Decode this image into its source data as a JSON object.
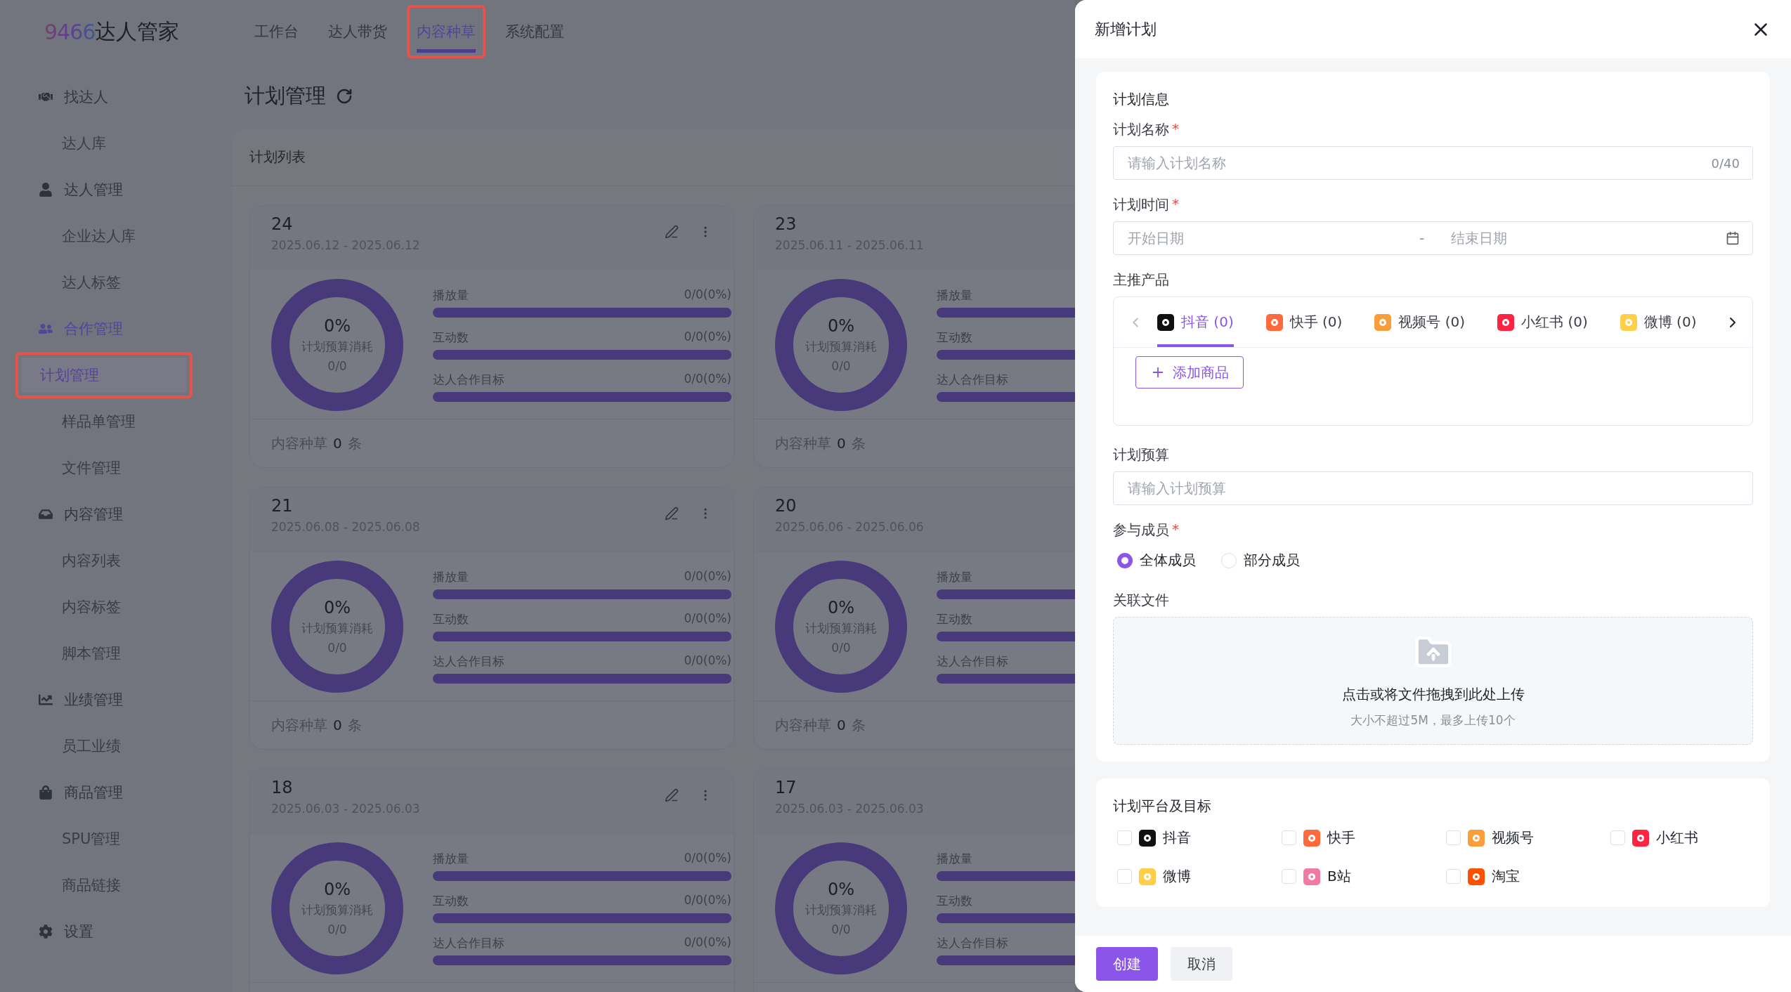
{
  "logo": {
    "number": "9466",
    "name": "达人管家"
  },
  "top_nav": [
    {
      "label": "工作台",
      "selected": false,
      "highlighted": false
    },
    {
      "label": "达人带货",
      "selected": false,
      "highlighted": false
    },
    {
      "label": "内容种草",
      "selected": true,
      "highlighted": true
    },
    {
      "label": "系统配置",
      "selected": false,
      "highlighted": false
    }
  ],
  "sidebar": {
    "items": [
      {
        "label": "找达人",
        "active": false,
        "children": [
          {
            "label": "达人库",
            "selected": false,
            "highlighted": false
          }
        ]
      },
      {
        "label": "达人管理",
        "active": false,
        "children": [
          {
            "label": "企业达人库",
            "selected": false,
            "highlighted": false
          },
          {
            "label": "达人标签",
            "selected": false,
            "highlighted": false
          }
        ]
      },
      {
        "label": "合作管理",
        "active": true,
        "children": [
          {
            "label": "计划管理",
            "selected": true,
            "highlighted": true
          },
          {
            "label": "样品单管理",
            "selected": false,
            "highlighted": false
          },
          {
            "label": "文件管理",
            "selected": false,
            "highlighted": false
          }
        ]
      },
      {
        "label": "内容管理",
        "active": false,
        "children": [
          {
            "label": "内容列表",
            "selected": false,
            "highlighted": false
          },
          {
            "label": "内容标签",
            "selected": false,
            "highlighted": false
          },
          {
            "label": "脚本管理",
            "selected": false,
            "highlighted": false
          }
        ]
      },
      {
        "label": "业绩管理",
        "active": false,
        "children": [
          {
            "label": "员工业绩",
            "selected": false,
            "highlighted": false
          }
        ]
      },
      {
        "label": "商品管理",
        "active": false,
        "children": [
          {
            "label": "SPU管理",
            "selected": false,
            "highlighted": false
          },
          {
            "label": "商品链接",
            "selected": false,
            "highlighted": false
          }
        ]
      },
      {
        "label": "设置",
        "active": false
      }
    ]
  },
  "page": {
    "title": "计划管理"
  },
  "panel": {
    "title": "计划列表",
    "cards": [
      {
        "number": "24",
        "dates": "2025.06.12 - 2025.06.12",
        "actions": true,
        "donut": {
          "percent": "0%",
          "label": "计划预算消耗",
          "value": "0/0"
        },
        "metrics": [
          {
            "label": "播放量",
            "value": "0/0(0%)",
            "level": 0
          },
          {
            "label": "互动数",
            "value": "0/0(0%)",
            "level": 0
          },
          {
            "label": "达人合作目标",
            "value": "0/0(0%)",
            "level": 0
          }
        ],
        "footer": {
          "label": "内容种草",
          "count": "0",
          "unit": "条"
        }
      },
      {
        "number": "23",
        "dates": "2025.06.11 - 2025.06.11",
        "donut": {
          "percent": "0%",
          "label": "计划预算消耗",
          "value": "0/0"
        },
        "metrics": [
          {
            "label": "播放量",
            "level": 0
          },
          {
            "label": "互动数",
            "level": 0
          },
          {
            "label": "达人合作目标",
            "level": 0
          }
        ],
        "footer": {
          "label": "内容种草",
          "count": "0",
          "unit": "条"
        }
      },
      {
        "number": "21",
        "dates": "2025.06.08 - 2025.06.08",
        "actions": true,
        "donut": {
          "percent": "0%",
          "label": "计划预算消耗",
          "value": "0/0"
        },
        "metrics": [
          {
            "label": "播放量",
            "value": "0/0(0%)",
            "level": 0
          },
          {
            "label": "互动数",
            "value": "0/0(0%)",
            "level": 0
          },
          {
            "label": "达人合作目标",
            "value": "0/0(0%)",
            "level": 0
          }
        ],
        "footer": {
          "label": "内容种草",
          "count": "0",
          "unit": "条"
        }
      },
      {
        "number": "20",
        "dates": "2025.06.06 - 2025.06.06",
        "donut": {
          "percent": "0%",
          "label": "计划预算消耗",
          "value": "0/0"
        },
        "metrics": [
          {
            "label": "播放量",
            "level": 0
          },
          {
            "label": "互动数",
            "level": 0
          },
          {
            "label": "达人合作目标",
            "level": 0
          }
        ],
        "footer": {
          "label": "内容种草",
          "count": "0",
          "unit": "条"
        }
      },
      {
        "number": "18",
        "dates": "2025.06.03 - 2025.06.03",
        "actions": true,
        "donut": {
          "percent": "0%",
          "label": "计划预算消耗",
          "value": "0/0"
        },
        "metrics": [
          {
            "label": "播放量",
            "value": "0/0(0%)",
            "level": 0
          },
          {
            "label": "互动数",
            "value": "0/0(0%)",
            "level": 0
          },
          {
            "label": "达人合作目标",
            "value": "0/0(0%)",
            "level": 0
          }
        ]
      },
      {
        "number": "17",
        "dates": "2025.06.03 - 2025.06.03",
        "donut": {
          "percent": "0%",
          "label": "计划预算消耗",
          "value": "0/0"
        },
        "metrics": [
          {
            "label": "播放量",
            "level": 0
          },
          {
            "label": "互动数",
            "level": 0
          },
          {
            "label": "达人合作目标",
            "level": 0
          }
        ]
      }
    ]
  },
  "drawer": {
    "title": "新增计划",
    "info": {
      "heading": "计划信息",
      "name_field": {
        "label": "计划名称",
        "required_mark": "*",
        "placeholder": "请输入计划名称",
        "counter": "0/40"
      },
      "date_field": {
        "label": "计划时间",
        "required_mark": "*",
        "start_placeholder": "开始日期",
        "separator": "-",
        "end_placeholder": "结束日期"
      },
      "products": {
        "label": "主推产品",
        "tabs": [
          {
            "label": "抖音 (0)",
            "color": "#111111",
            "selected": true
          },
          {
            "label": "快手 (0)",
            "color": "#ff6a3d",
            "selected": false
          },
          {
            "label": "视频号 (0)",
            "color": "#fa9d3b",
            "selected": false
          },
          {
            "label": "小红书 (0)",
            "color": "#ff2442",
            "selected": false
          },
          {
            "label": "微博 (0)",
            "color": "#ffcf4a",
            "selected": false
          }
        ],
        "add_button": "添加商品"
      },
      "budget_field": {
        "label": "计划预算",
        "placeholder": "请输入计划预算"
      },
      "members": {
        "label": "参与成员",
        "required_mark": "*",
        "options": [
          {
            "label": "全体成员",
            "selected": true
          },
          {
            "label": "部分成员",
            "selected": false
          }
        ]
      },
      "files": {
        "label": "关联文件",
        "hint": "点击或将文件拖拽到此处上传",
        "limit": "大小不超过5M，最多上传10个"
      }
    },
    "platforms": {
      "heading": "计划平台及目标",
      "options": [
        {
          "label": "抖音",
          "color": "#111111",
          "checked": false
        },
        {
          "label": "快手",
          "color": "#ff6a3d",
          "checked": false
        },
        {
          "label": "视频号",
          "color": "#fa9d3b",
          "checked": false
        },
        {
          "label": "小红书",
          "color": "#ff2442",
          "checked": false
        },
        {
          "label": "微博",
          "color": "#ffcf4a",
          "checked": false
        },
        {
          "label": "B站",
          "color": "#f07aa0",
          "checked": false
        },
        {
          "label": "淘宝",
          "color": "#ff5000",
          "checked": false
        }
      ]
    },
    "buttons": [
      {
        "label": "创建",
        "kind": "primary"
      },
      {
        "label": "取消",
        "kind": "secondary"
      }
    ]
  }
}
